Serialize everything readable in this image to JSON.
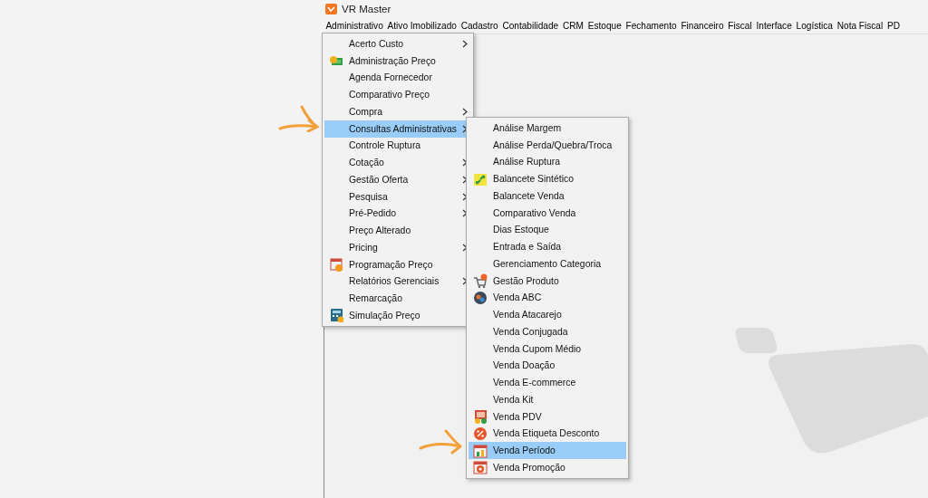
{
  "window": {
    "title": "VR Master"
  },
  "menu_bar": [
    {
      "label": "Administrativo",
      "selected": false
    },
    {
      "label": "Ativo Imobilizado",
      "selected": false
    },
    {
      "label": "Cadastro",
      "selected": false
    },
    {
      "label": "Contabilidade",
      "selected": false
    },
    {
      "label": "CRM",
      "selected": false
    },
    {
      "label": "Estoque",
      "selected": false
    },
    {
      "label": "Fechamento",
      "selected": false
    },
    {
      "label": "Financeiro",
      "selected": false
    },
    {
      "label": "Fiscal",
      "selected": false
    },
    {
      "label": "Interface",
      "selected": false
    },
    {
      "label": "Logística",
      "selected": false
    },
    {
      "label": "Nota Fiscal",
      "selected": false
    },
    {
      "label": "PD",
      "selected": false
    }
  ],
  "menu": [
    {
      "label": "Acerto Custo",
      "submenu": true,
      "selected": false
    },
    {
      "label": "Administração Preço",
      "submenu": false,
      "selected": false,
      "kind": "money"
    },
    {
      "label": "Agenda Fornecedor",
      "submenu": false,
      "selected": false
    },
    {
      "label": "Comparativo Preço",
      "submenu": false,
      "selected": false
    },
    {
      "label": "Compra",
      "submenu": true,
      "selected": false
    },
    {
      "label": "Consultas Administrativas",
      "submenu": true,
      "selected": true
    },
    {
      "label": "Controle Ruptura",
      "submenu": false,
      "selected": false
    },
    {
      "label": "Cotação",
      "submenu": true,
      "selected": false
    },
    {
      "label": "Gestão Oferta",
      "submenu": true,
      "selected": false
    },
    {
      "label": "Pesquisa",
      "submenu": true,
      "selected": false
    },
    {
      "label": "Pré-Pedido",
      "submenu": true,
      "selected": false
    },
    {
      "label": "Preço Alterado",
      "submenu": false,
      "selected": false
    },
    {
      "label": "Pricing",
      "submenu": true,
      "selected": false
    },
    {
      "label": "Programação Preço",
      "submenu": false,
      "selected": false,
      "kind": "calendar"
    },
    {
      "label": "Relatórios Gerenciais",
      "submenu": true,
      "selected": false
    },
    {
      "label": "Remarcação",
      "submenu": false,
      "selected": false
    },
    {
      "label": "Simulação Preço",
      "submenu": false,
      "selected": false,
      "kind": "calculator"
    }
  ],
  "submenu": [
    {
      "label": "Análise Margem",
      "submenu": false,
      "selected": false
    },
    {
      "label": "Análise Perda/Quebra/Troca",
      "submenu": false,
      "selected": false
    },
    {
      "label": "Análise Ruptura",
      "submenu": false,
      "selected": false
    },
    {
      "label": "Balancete Sintético",
      "submenu": false,
      "selected": false,
      "kind": "exchange"
    },
    {
      "label": "Balancete Venda",
      "submenu": false,
      "selected": false
    },
    {
      "label": "Comparativo Venda",
      "submenu": false,
      "selected": false
    },
    {
      "label": "Dias Estoque",
      "submenu": false,
      "selected": false
    },
    {
      "label": "Entrada e Saída",
      "submenu": false,
      "selected": false
    },
    {
      "label": "Gerenciamento Categoria",
      "submenu": false,
      "selected": false
    },
    {
      "label": "Gestão Produto",
      "submenu": false,
      "selected": false,
      "kind": "cart"
    },
    {
      "label": "Venda ABC",
      "submenu": false,
      "selected": false,
      "kind": "globe"
    },
    {
      "label": "Venda Atacarejo",
      "submenu": false,
      "selected": false
    },
    {
      "label": "Venda Conjugada",
      "submenu": false,
      "selected": false
    },
    {
      "label": "Venda Cupom Médio",
      "submenu": false,
      "selected": false
    },
    {
      "label": "Venda Doação",
      "submenu": false,
      "selected": false
    },
    {
      "label": "Venda E-commerce",
      "submenu": false,
      "selected": false
    },
    {
      "label": "Venda Kit",
      "submenu": false,
      "selected": false
    },
    {
      "label": "Venda PDV",
      "submenu": false,
      "selected": false,
      "kind": "monitor"
    },
    {
      "label": "Venda Etiqueta Desconto",
      "submenu": false,
      "selected": false,
      "kind": "percent"
    },
    {
      "label": "Venda Período",
      "submenu": false,
      "selected": true,
      "kind": "chart"
    },
    {
      "label": "Venda Promoção",
      "submenu": false,
      "selected": false,
      "kind": "target"
    }
  ]
}
